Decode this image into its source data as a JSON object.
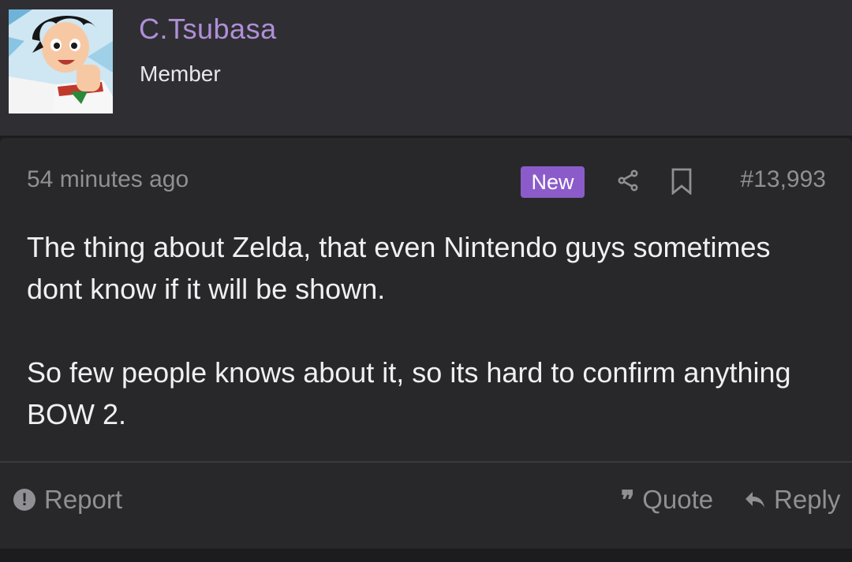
{
  "user": {
    "name": "C.Tsubasa",
    "title": "Member"
  },
  "post": {
    "timestamp": "54 minutes ago",
    "badge": "New",
    "number": "#13,993",
    "paragraphs": [
      "The thing about Zelda, that even Nintendo guys sometimes dont know if it will be shown.",
      "So few people knows about it, so its hard to confirm anything BOW 2."
    ]
  },
  "actions": {
    "report_label": "Report",
    "quote_label": "Quote",
    "reply_label": "Reply"
  },
  "icons": {
    "share": "share-icon",
    "bookmark": "bookmark-icon",
    "report": "exclamation-circle-icon",
    "quote": "quote-icon",
    "reply": "reply-arrow-icon"
  },
  "colors": {
    "username": "#b08fd9",
    "badge": "#8b5cc9",
    "muted_text": "#8f8f94",
    "body_text": "#f0f0f2"
  }
}
